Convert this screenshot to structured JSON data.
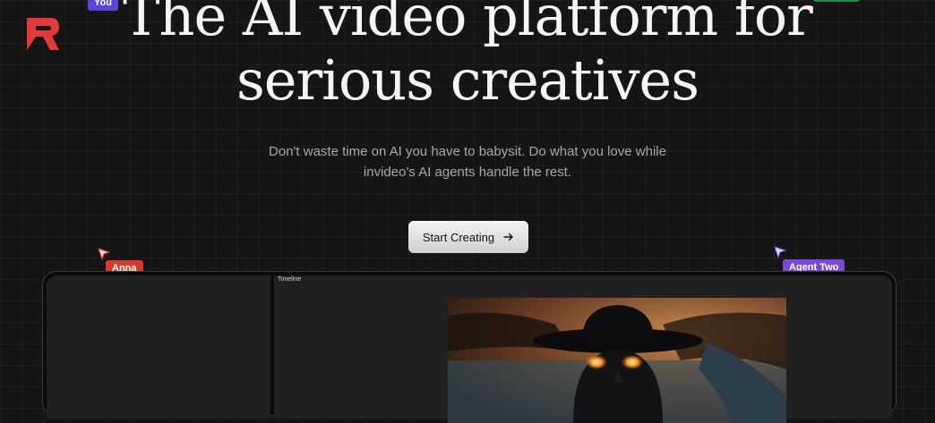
{
  "header": {
    "logo_icon": "red-r-logo-icon",
    "brand_color": "#e23a3a"
  },
  "cursors": {
    "you_label": "You",
    "anna_label": "Anna",
    "agent_label": "Agent Two"
  },
  "hero": {
    "title_line1": "The AI video platform for",
    "title_line2": "serious creatives",
    "subtitle_line1": "Don't waste time on AI you have to babysit. Do what you love while",
    "subtitle_line2": "invideo's AI agents handle the rest.",
    "cta_label": "Start Creating",
    "cta_icon": "arrow-right-icon"
  },
  "editor": {
    "timeline_label": "Timeline"
  },
  "colors": {
    "background": "#151515",
    "anna_tag": "#d83a2a",
    "agent_tag": "#7a49d8",
    "you_tag": "#5a46d6"
  }
}
